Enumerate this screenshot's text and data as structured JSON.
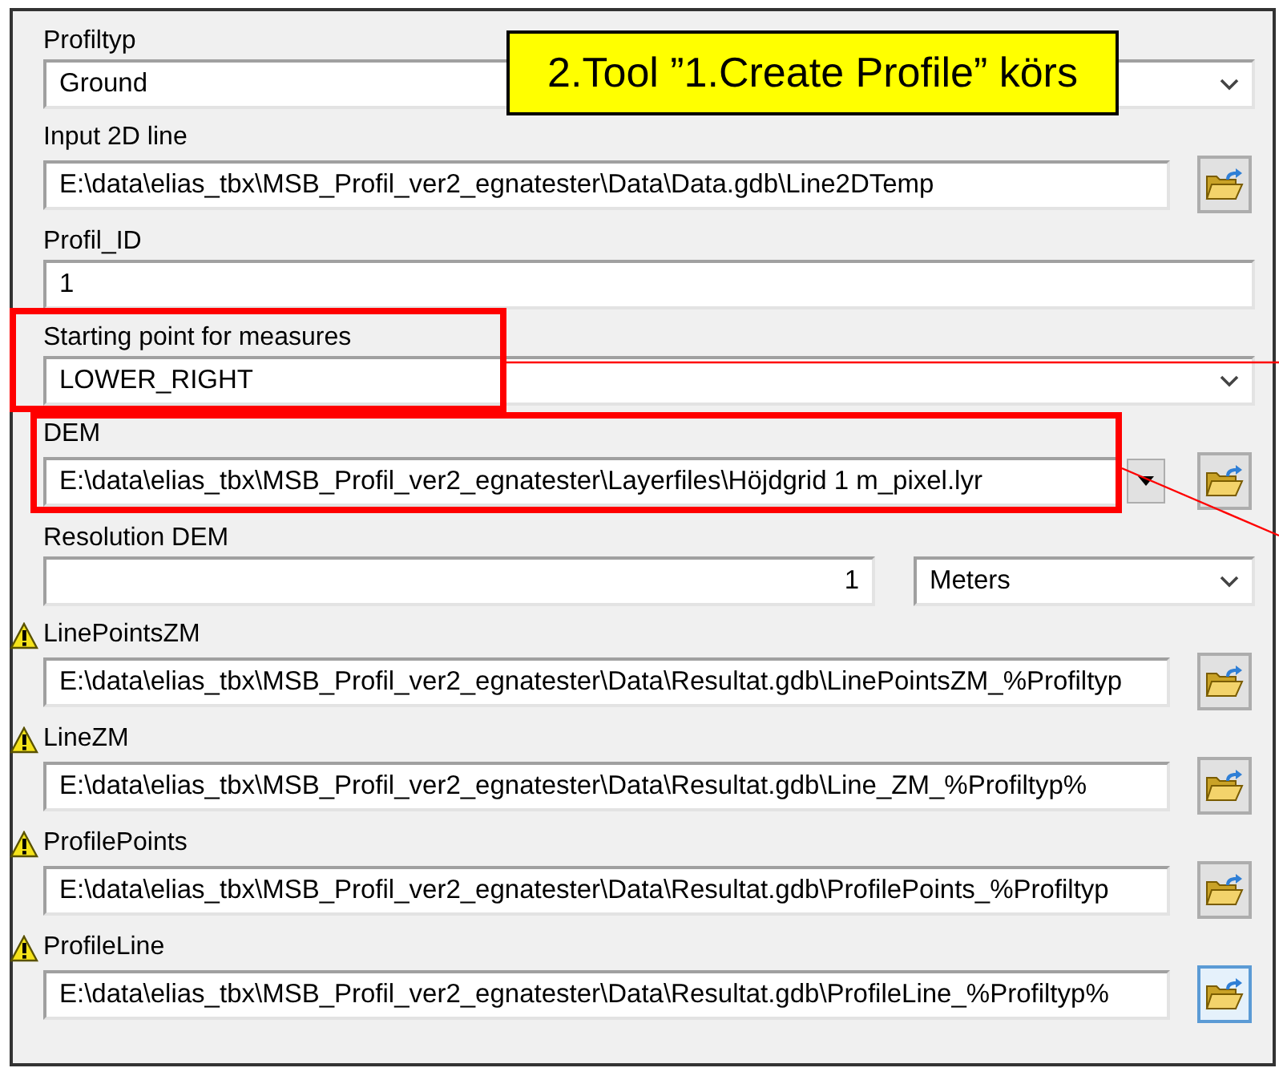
{
  "callout": {
    "text": "2.Tool ”1.Create Profile” körs"
  },
  "parameters": [
    {
      "kind": "dropdown",
      "label": "Profiltyp",
      "value": "Ground",
      "warning": false,
      "highlighted": false
    },
    {
      "kind": "path",
      "label": "Input 2D line",
      "value": "E:\\data\\elias_tbx\\MSB_Profil_ver2_egnatester\\Data\\Data.gdb\\Line2DTemp",
      "warning": false,
      "highlighted": false,
      "focused": false
    },
    {
      "kind": "text",
      "label": "Profil_ID",
      "value": "1",
      "warning": false,
      "highlighted": false
    },
    {
      "kind": "dropdown",
      "label": "Starting point for measures",
      "value": "LOWER_RIGHT",
      "warning": false,
      "highlighted": true
    },
    {
      "kind": "path_dropdown",
      "label": "DEM",
      "value": "E:\\data\\elias_tbx\\MSB_Profil_ver2_egnatester\\Layerfiles\\Höjdgrid 1 m_pixel.lyr",
      "warning": false,
      "highlighted": true,
      "focused": false
    },
    {
      "kind": "number_unit",
      "label": "Resolution DEM",
      "value": "1",
      "unit": "Meters",
      "warning": false,
      "highlighted": false
    },
    {
      "kind": "path",
      "label": "LinePointsZM",
      "value": "E:\\data\\elias_tbx\\MSB_Profil_ver2_egnatester\\Data\\Resultat.gdb\\LinePointsZM_%Profiltyp",
      "warning": true,
      "highlighted": false,
      "focused": false
    },
    {
      "kind": "path",
      "label": "LineZM",
      "value": "E:\\data\\elias_tbx\\MSB_Profil_ver2_egnatester\\Data\\Resultat.gdb\\Line_ZM_%Profiltyp%",
      "warning": true,
      "highlighted": false,
      "focused": false
    },
    {
      "kind": "path",
      "label": "ProfilePoints",
      "value": "E:\\data\\elias_tbx\\MSB_Profil_ver2_egnatester\\Data\\Resultat.gdb\\ProfilePoints_%Profiltyp",
      "warning": true,
      "highlighted": false,
      "focused": false
    },
    {
      "kind": "path",
      "label": "ProfileLine",
      "value": "E:\\data\\elias_tbx\\MSB_Profil_ver2_egnatester\\Data\\Resultat.gdb\\ProfileLine_%Profiltyp%",
      "warning": true,
      "highlighted": false,
      "focused": true
    }
  ]
}
